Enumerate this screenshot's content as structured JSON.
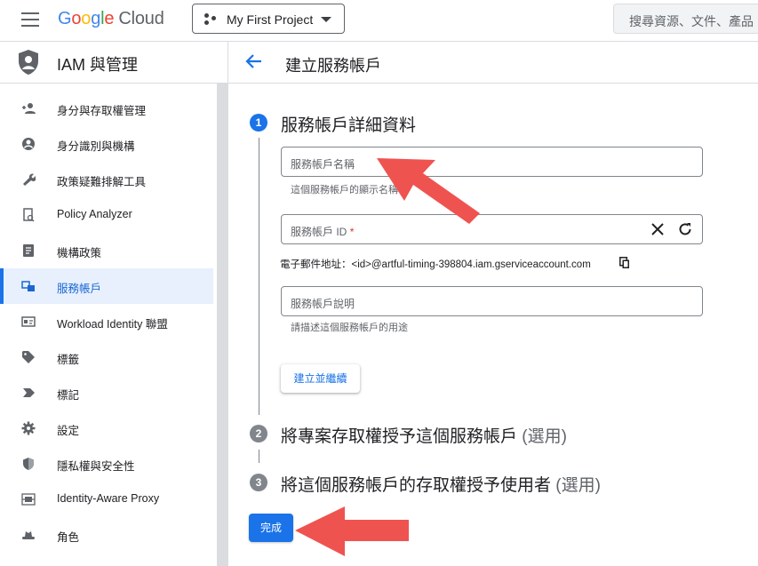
{
  "header": {
    "logo": {
      "g": "G",
      "o1": "o",
      "o2": "o",
      "g2": "g",
      "l": "l",
      "e": "e",
      "cloud": "Cloud"
    },
    "project_name": "My First Project",
    "search_placeholder": "搜尋資源、文件、產品"
  },
  "sidebar": {
    "title": "IAM 與管理",
    "items": [
      {
        "label": "身分與存取權管理",
        "icon": "person-add-icon"
      },
      {
        "label": "身分識別與機構",
        "icon": "account-circle-icon"
      },
      {
        "label": "政策疑難排解工具",
        "icon": "wrench-icon"
      },
      {
        "label": "Policy Analyzer",
        "icon": "policy-doc-icon"
      },
      {
        "label": "機構政策",
        "icon": "list-doc-icon"
      },
      {
        "label": "服務帳戶",
        "icon": "service-account-icon",
        "active": true
      },
      {
        "label": "Workload Identity 聯盟",
        "icon": "id-card-icon"
      },
      {
        "label": "標籤",
        "icon": "tag-icon"
      },
      {
        "label": "標記",
        "icon": "label-icon"
      },
      {
        "label": "設定",
        "icon": "gear-icon"
      },
      {
        "label": "隱私權與安全性",
        "icon": "shield-icon"
      },
      {
        "label": "Identity-Aware Proxy",
        "icon": "proxy-icon"
      },
      {
        "label": "角色",
        "icon": "hat-icon"
      }
    ]
  },
  "page": {
    "title": "建立服務帳戶",
    "step1": {
      "number": "1",
      "title": "服務帳戶詳細資料",
      "name_placeholder": "服務帳戶名稱",
      "name_hint": "這個服務帳戶的顯示名稱",
      "id_label": "服務帳戶 ID",
      "id_required": "*",
      "email": "電子郵件地址：<id>@artful-timing-398804.iam.gserviceaccount.com",
      "desc_placeholder": "服務帳戶說明",
      "desc_hint": "請描述這個服務帳戶的用途",
      "create_button": "建立並繼續"
    },
    "step2": {
      "number": "2",
      "title": "將專案存取權授予這個服務帳戶",
      "optional": "(選用)"
    },
    "step3": {
      "number": "3",
      "title": "將這個服務帳戶的存取權授予使用者",
      "optional": "(選用)"
    },
    "done_button": "完成"
  },
  "colors": {
    "accent": "#1a73e8",
    "annotation_arrow": "#ef5350"
  }
}
